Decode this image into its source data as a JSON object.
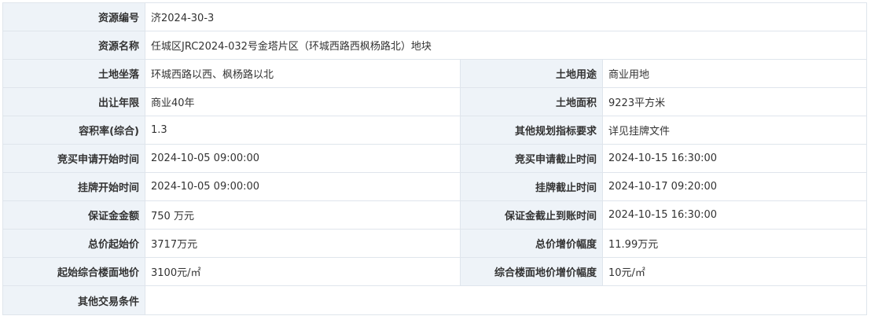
{
  "rows": {
    "resource_no": {
      "label": "资源编号",
      "value": "济2024-30-3"
    },
    "resource_name": {
      "label": "资源名称",
      "value": "任城区JRC2024-032号金塔片区（环城西路西枫杨路北）地块"
    },
    "location": {
      "label": "土地坐落",
      "value": "环城西路以西、枫杨路以北"
    },
    "land_use": {
      "label": "土地用途",
      "value": "商业用地"
    },
    "term": {
      "label": "出让年限",
      "value": "商业40年"
    },
    "area": {
      "label": "土地面积",
      "value": "9223平方米"
    },
    "far": {
      "label": "容积率(综合)",
      "value": "1.3"
    },
    "other_planning": {
      "label": "其他规划指标要求",
      "value": "详见挂牌文件"
    },
    "bid_apply_start": {
      "label": "竞买申请开始时间",
      "value": "2024-10-05 09:00:00"
    },
    "bid_apply_end": {
      "label": "竞买申请截止时间",
      "value": "2024-10-15 16:30:00"
    },
    "listing_start": {
      "label": "挂牌开始时间",
      "value": "2024-10-05 09:00:00"
    },
    "listing_end": {
      "label": "挂牌截止时间",
      "value": "2024-10-17 09:20:00"
    },
    "deposit": {
      "label": "保证金金额",
      "value": "750 万元"
    },
    "deposit_deadline": {
      "label": "保证金截止到账时间",
      "value": "2024-10-15 16:30:00"
    },
    "start_price": {
      "label": "总价起始价",
      "value": "3717万元"
    },
    "increment": {
      "label": "总价增价幅度",
      "value": "11.99万元"
    },
    "floor_price": {
      "label": "起始综合楼面地价",
      "value": "3100元/㎡"
    },
    "floor_increment": {
      "label": "综合楼面地价增价幅度",
      "value": "10元/㎡"
    },
    "other_conditions": {
      "label": "其他交易条件",
      "value": ""
    }
  }
}
